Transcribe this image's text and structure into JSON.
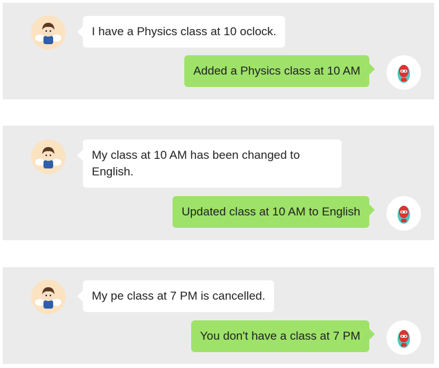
{
  "colors": {
    "panel_bg": "#ebebeb",
    "user_bubble": "#ffffff",
    "bot_bubble": "#9ee26a",
    "user_avatar_bg": "#fbe3c2"
  },
  "icons": {
    "user_avatar": "angel-boy-avatar-icon",
    "bot_avatar": "red-robot-avatar-icon"
  },
  "conversations": [
    {
      "user_message": "I have a Physics class at 10 oclock.",
      "bot_reply": "Added a Physics class at 10 AM"
    },
    {
      "user_message": "My class at 10 AM has been changed to English.",
      "bot_reply": "Updated class at 10 AM to English"
    },
    {
      "user_message": "My pe class at 7 PM is cancelled.",
      "bot_reply": "You don't have a class at 7 PM"
    }
  ]
}
